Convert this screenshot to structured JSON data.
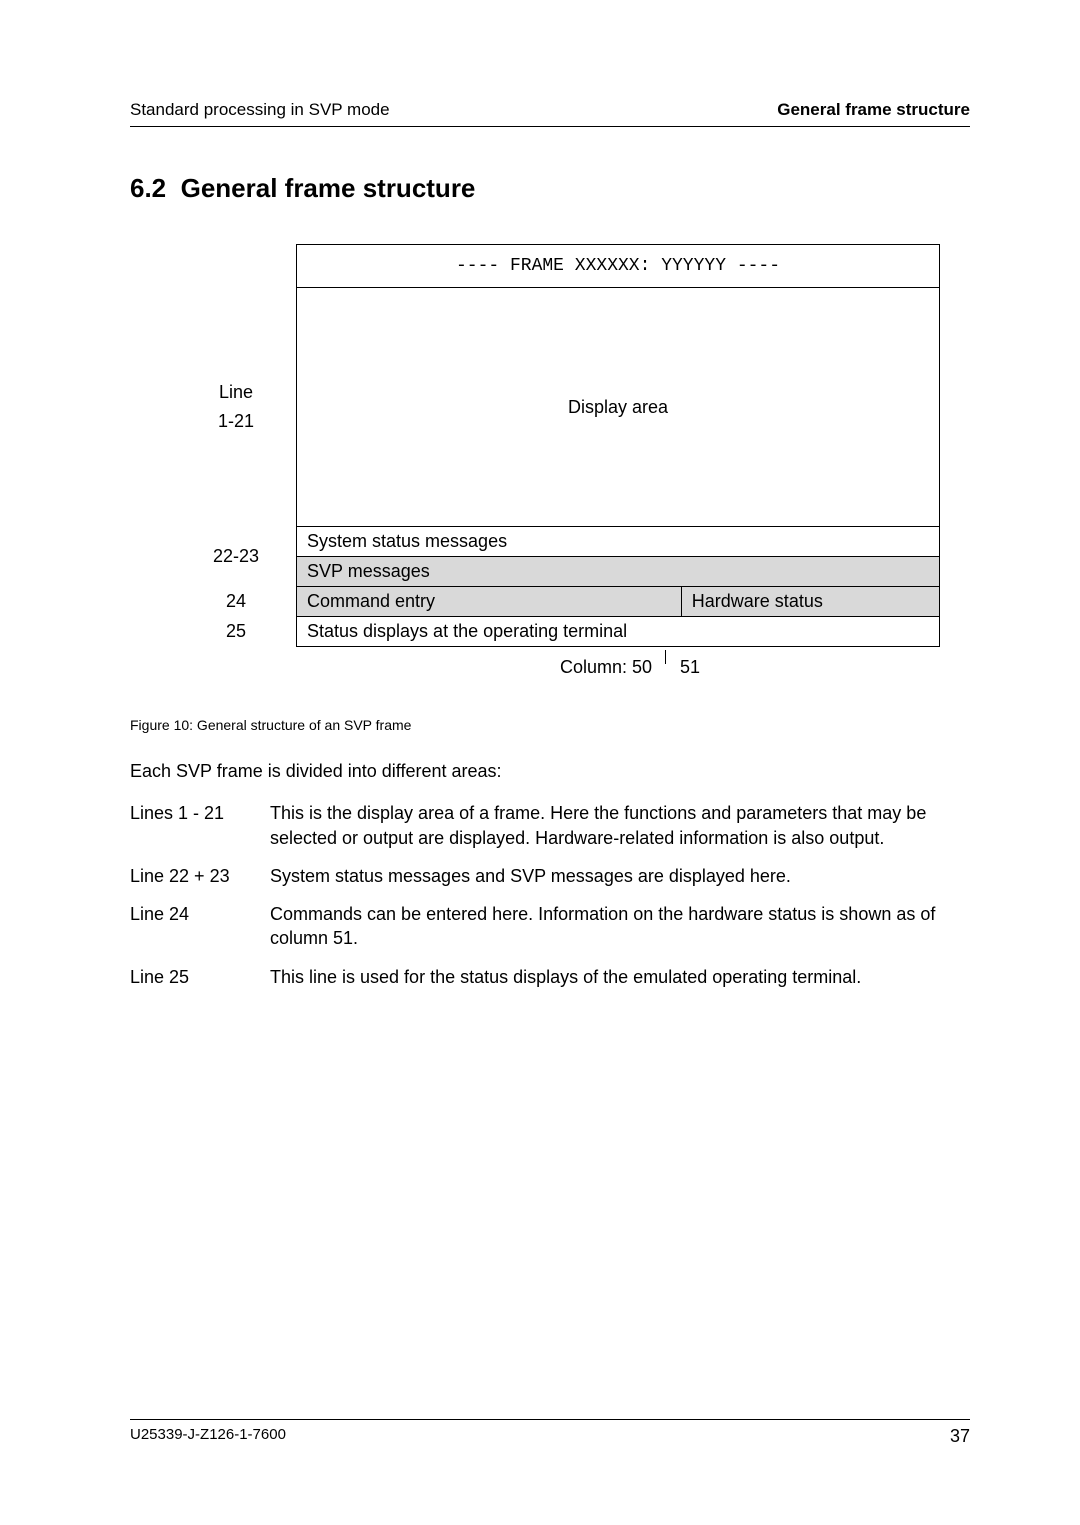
{
  "header": {
    "left": "Standard processing in SVP mode",
    "right": "General frame structure"
  },
  "section": {
    "number": "6.2",
    "title": "General frame structure"
  },
  "diagram": {
    "frame_title": "---- FRAME XXXXXX: YYYYYY ----",
    "line_label_word": "Line",
    "line_label_range": "1-21",
    "display_area": "Display area",
    "row_22_23_label": "22-23",
    "system_status": "System status messages",
    "svp_messages": "SVP messages",
    "row_24_label": "24",
    "command_entry": "Command entry",
    "hardware_status": "Hardware status",
    "row_25_label": "25",
    "status_displays": "Status displays at the operating terminal",
    "column_label": "Column: 50",
    "column_51": "51"
  },
  "figure_caption": "Figure 10: General structure of an SVP frame",
  "intro_text": "Each SVP frame is divided into different areas:",
  "definitions": [
    {
      "term": "Lines 1 - 21",
      "desc": "This is the display area of a frame. Here the functions and parameters that may be selected or output are displayed. Hardware-related information is also output."
    },
    {
      "term": "Line 22 + 23",
      "desc": "System status messages and SVP messages are displayed here."
    },
    {
      "term": "Line 24",
      "desc": "Commands can be entered here. Information on the hardware status is shown as of column 51."
    },
    {
      "term": "Line 25",
      "desc": "This line is used for the status displays of the emulated operating terminal."
    }
  ],
  "footer": {
    "doc_id": "U25339-J-Z126-1-7600",
    "page": "37"
  }
}
